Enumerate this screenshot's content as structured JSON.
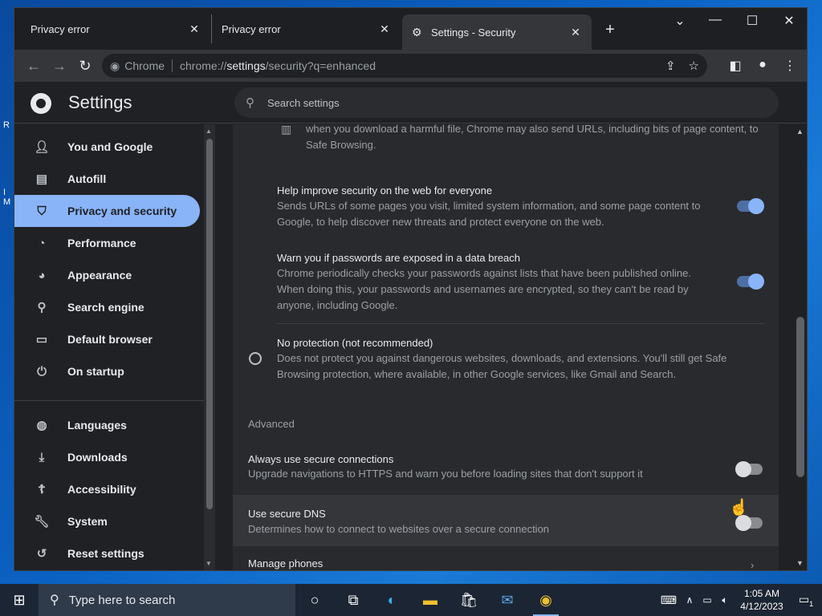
{
  "tabs": [
    {
      "title": "Privacy error"
    },
    {
      "title": "Privacy error"
    },
    {
      "title": "Settings - Security"
    }
  ],
  "omnibox": {
    "site": "Chrome",
    "url_prefix": "chrome://",
    "url_host": "settings",
    "url_rest": "/security?q=enhanced"
  },
  "settings": {
    "title": "Settings",
    "search_placeholder": "Search settings"
  },
  "sidebar": {
    "items": [
      {
        "label": "You and Google",
        "icon": "person-icon"
      },
      {
        "label": "Autofill",
        "icon": "clipboard-icon"
      },
      {
        "label": "Privacy and security",
        "icon": "shield-icon"
      },
      {
        "label": "Performance",
        "icon": "speedometer-icon"
      },
      {
        "label": "Appearance",
        "icon": "palette-icon"
      },
      {
        "label": "Search engine",
        "icon": "search-icon"
      },
      {
        "label": "Default browser",
        "icon": "browser-icon"
      },
      {
        "label": "On startup",
        "icon": "power-icon"
      },
      {
        "label": "Languages",
        "icon": "globe-icon"
      },
      {
        "label": "Downloads",
        "icon": "download-icon"
      },
      {
        "label": "Accessibility",
        "icon": "accessibility-icon"
      },
      {
        "label": "System",
        "icon": "wrench-icon"
      },
      {
        "label": "Reset settings",
        "icon": "history-icon"
      }
    ],
    "selected": "Privacy and security"
  },
  "content": {
    "top_desc": "when you download a harmful file, Chrome may also send URLs, including bits of page content, to Safe Browsing.",
    "help_improve": {
      "title": "Help improve security on the web for everyone",
      "desc": "Sends URLs of some pages you visit, limited system information, and some page content to Google, to help discover new threats and protect everyone on the web.",
      "enabled": true
    },
    "warn_passwords": {
      "title": "Warn you if passwords are exposed in a data breach",
      "desc": "Chrome periodically checks your passwords against lists that have been published online. When doing this, your passwords and usernames are encrypted, so they can't be read by anyone, including Google.",
      "enabled": true
    },
    "no_protection": {
      "title": "No protection (not recommended)",
      "desc": "Does not protect you against dangerous websites, downloads, and extensions. You'll still get Safe Browsing protection, where available, in other Google services, like Gmail and Search."
    },
    "advanced_label": "Advanced",
    "secure_connections": {
      "title": "Always use secure connections",
      "desc": "Upgrade navigations to HTTPS and warn you before loading sites that don't support it",
      "enabled": false
    },
    "secure_dns": {
      "title": "Use secure DNS",
      "desc": "Determines how to connect to websites over a secure connection",
      "enabled": false
    },
    "manage_phones": {
      "title": "Manage phones"
    }
  },
  "taskbar": {
    "search_placeholder": "Type here to search",
    "time": "1:05 AM",
    "date": "4/12/2023",
    "notification_count": "1"
  }
}
